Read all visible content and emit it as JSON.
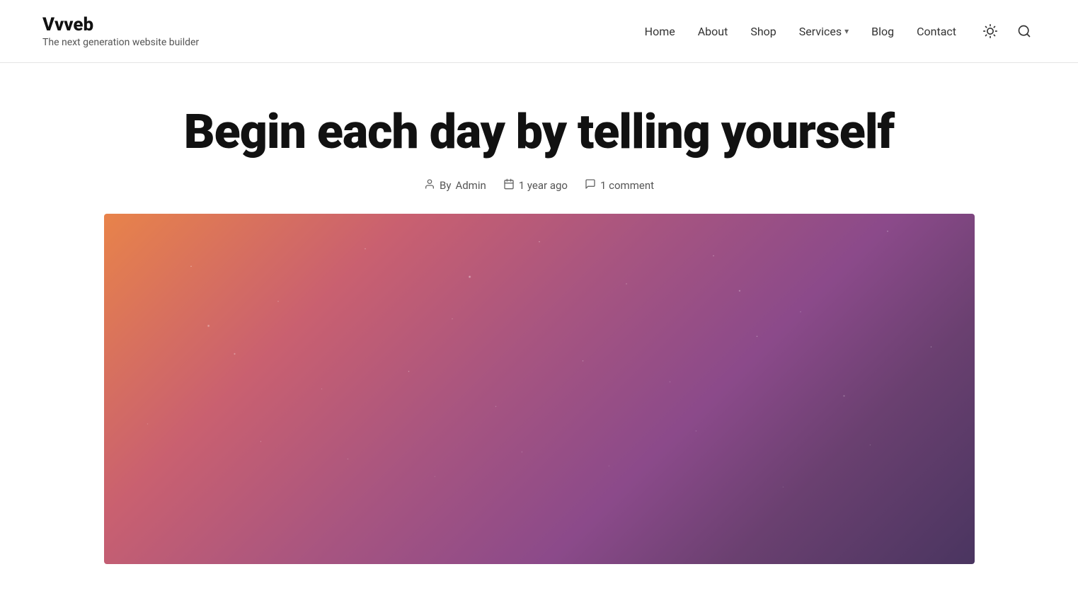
{
  "site": {
    "title": "Vvveb",
    "tagline": "The next generation website builder"
  },
  "nav": {
    "items": [
      {
        "label": "Home",
        "id": "home",
        "has_dropdown": false
      },
      {
        "label": "About",
        "id": "about",
        "has_dropdown": false
      },
      {
        "label": "Shop",
        "id": "shop",
        "has_dropdown": false
      },
      {
        "label": "Services",
        "id": "services",
        "has_dropdown": true
      },
      {
        "label": "Blog",
        "id": "blog",
        "has_dropdown": false
      },
      {
        "label": "Contact",
        "id": "contact",
        "has_dropdown": false
      }
    ]
  },
  "post": {
    "title": "Begin each day by telling yourself",
    "author": "Admin",
    "date": "1 year ago",
    "comments": "1 comment",
    "by_label": "By"
  }
}
